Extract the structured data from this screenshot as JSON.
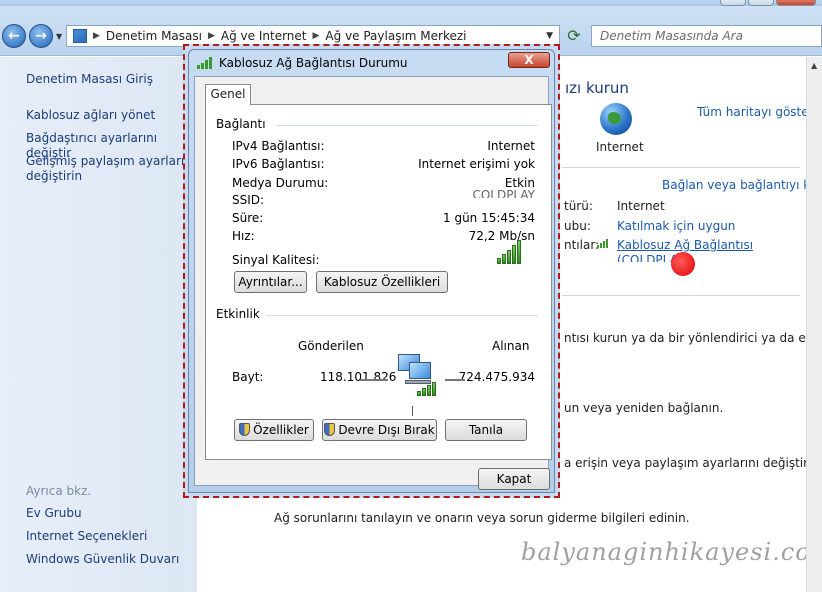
{
  "explorer": {
    "breadcrumb": [
      "Denetim Masası",
      "Ağ ve Internet",
      "Ağ ve Paylaşım Merkezi"
    ],
    "search_placeholder": "Denetim Masasında Ara"
  },
  "left_nav": {
    "links": [
      "Denetim Masası Giriş",
      "Kablosuz ağları yönet",
      "Bağdaştırıcı ayarlarını değiştir",
      "Gelişmiş paylaşım ayarlarını",
      "değiştirin"
    ],
    "see_also_label": "Ayrıca bkz.",
    "see_also": [
      "Ev Grubu",
      "Internet Seçenekleri",
      "Windows Güvenlik Duvarı"
    ]
  },
  "main": {
    "heading_fragment": "ızı kurun",
    "full_map_link": "Tüm haritayı göster",
    "internet_label": "Internet",
    "connect_link": "Bağlan veya bağlantıyı kes",
    "access_type_label": "türü:",
    "access_type_value": "Internet",
    "homegroup_label": "ubu:",
    "homegroup_value": "Katılmak için uygun",
    "connections_label": "ntılar:",
    "connection_link": "Kablosuz Ağ Bağlantısı",
    "connection_ssid_partial": "(COLDPLAY)",
    "task1": "ntısı kurun ya da bir yönlendirici ya da erişim",
    "task2": "un veya yeniden bağlanın.",
    "task3": "a erişin veya paylaşım ayarlarını değiştirin.",
    "task4": "Ağ sorunlarını tanılayın ve onarın veya sorun giderme bilgileri edinin.",
    "watermark": "balyanaginhikayesi.com"
  },
  "dialog": {
    "title": "Kablosuz Ağ Bağlantısı Durumu",
    "close_label": "X",
    "tab": "Genel",
    "connection_group": "Bağlantı",
    "rows": [
      {
        "label": "IPv4 Bağlantısı:",
        "value": "Internet"
      },
      {
        "label": "IPv6 Bağlantısı:",
        "value": "Internet erişimi yok"
      },
      {
        "label": "Medya Durumu:",
        "value": "Etkin"
      },
      {
        "label": "SSID:",
        "value": "COLDPLAY"
      },
      {
        "label": "Süre:",
        "value": "1 gün 15:45:34"
      },
      {
        "label": "Hız:",
        "value": "72,2 Mb/sn"
      }
    ],
    "signal_label": "Sinyal Kalitesi:",
    "signal_level": 5,
    "details_button": "Ayrıntılar...",
    "wireless_props_button": "Kablosuz Özellikleri",
    "activity_group": "Etkinlik",
    "sent_label": "Gönderilen",
    "received_label": "Alınan",
    "bytes_label": "Bayt:",
    "bytes_sent": "118.101.826",
    "bytes_received": "724.475.934",
    "properties_button": "Özellikler",
    "disable_button": "Devre Dışı Bırak",
    "diagnose_button": "Tanıla",
    "close_button": "Kapat"
  }
}
